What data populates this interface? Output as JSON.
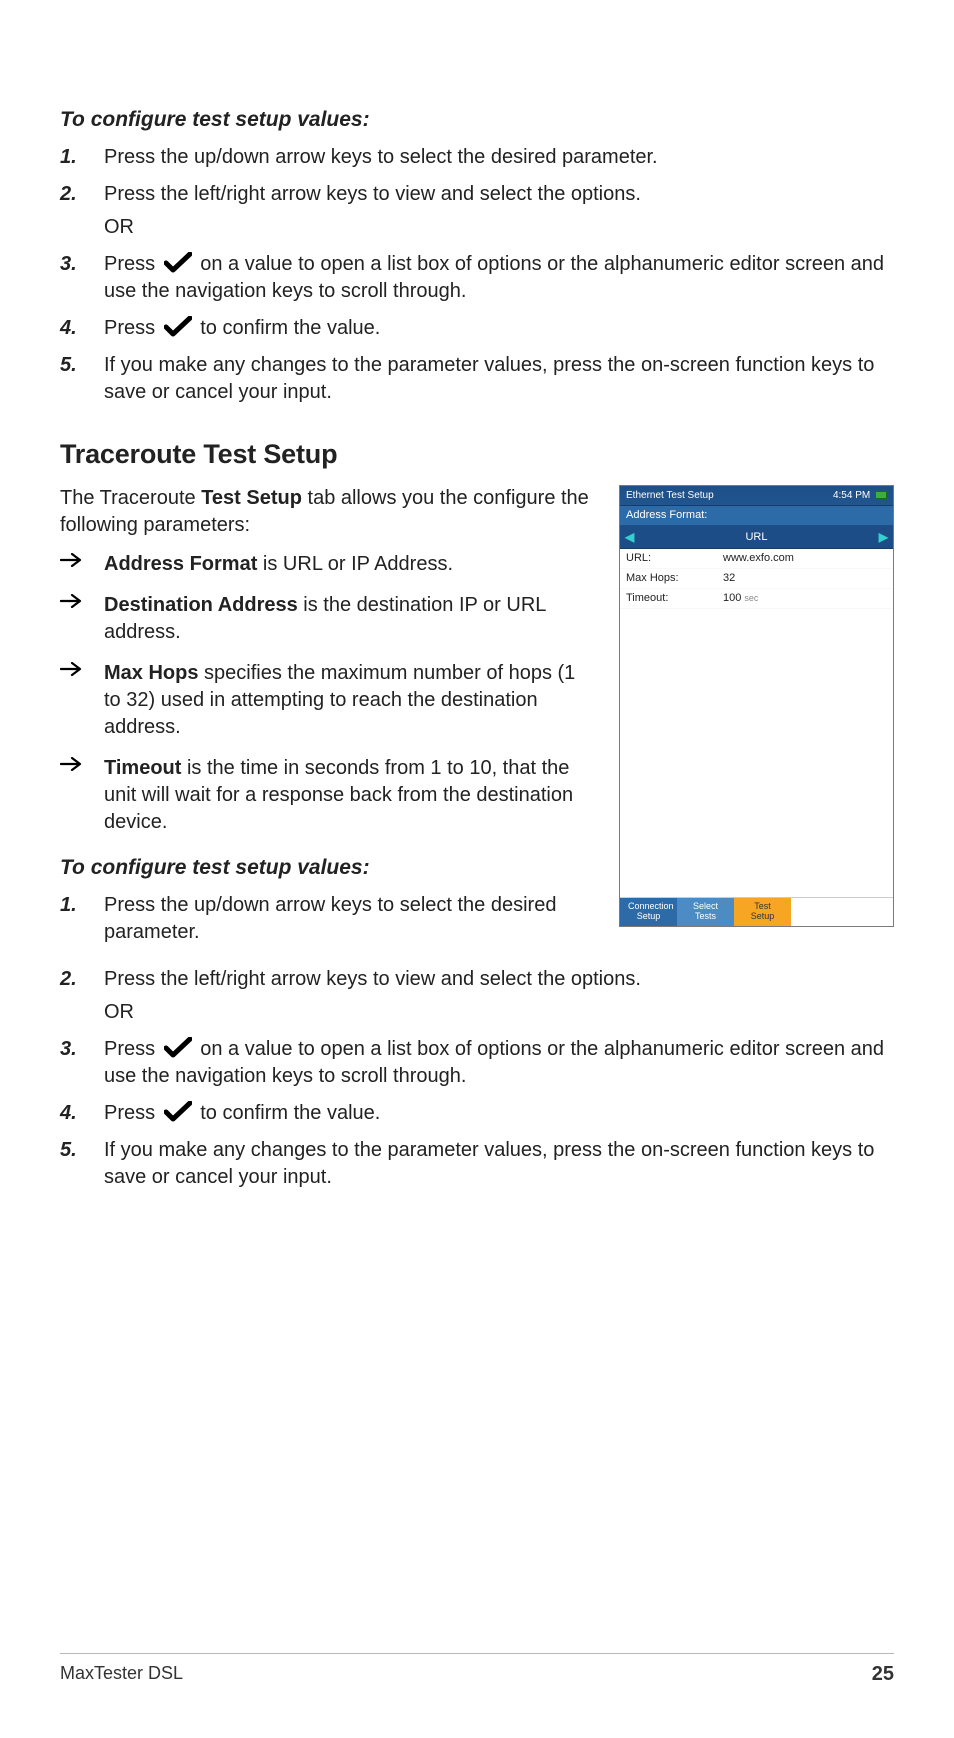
{
  "section1": {
    "heading": "To configure test setup values:",
    "items": {
      "n1": "1.",
      "t1": "Press the up/down arrow keys to select the desired parameter.",
      "n2": "2.",
      "t2": "Press the left/right arrow keys to view and select the options.",
      "or": "OR",
      "n3": "3.",
      "t3a": "Press ",
      "t3b": " on a value to open a list box of options or the alphanumeric editor screen and use the navigation keys to scroll through.",
      "n4": "4.",
      "t4a": "Press ",
      "t4b": " to confirm the value.",
      "n5": "5.",
      "t5": "If you make any changes to the parameter values, press the on-screen function keys to save or cancel your input."
    }
  },
  "h2": "Traceroute Test Setup",
  "intro_a": "The Traceroute ",
  "intro_bold": "Test Setup",
  "intro_b": " tab allows you the configure the following parameters:",
  "bullets": {
    "b1_bold": "Address Format",
    "b1_rest": " is URL or IP Address.",
    "b2_bold": "Destination Address",
    "b2_rest": " is the destination IP or URL address.",
    "b3_bold": "Max Hops",
    "b3_rest": " specifies the maximum number of hops (1 to 32) used in attempting to reach the destination address.",
    "b4_bold": "Timeout",
    "b4_rest": " is the time in seconds from 1 to 10, that the unit will wait for a response back from the destination device."
  },
  "section2": {
    "heading": "To configure test setup values:",
    "items": {
      "n1": "1.",
      "t1": "Press the up/down arrow keys to select the desired parameter.",
      "n2": "2.",
      "t2": "Press the left/right arrow keys to view and select the options.",
      "or": "OR",
      "n3": "3.",
      "t3a": "Press ",
      "t3b": " on a value to open a list box of options or the alphanumeric editor screen and use the navigation keys to scroll through.",
      "n4": "4.",
      "t4a": "Press ",
      "t4b": " to confirm the value.",
      "n5": "5.",
      "t5": "If you make any changes to the parameter values, press the on-screen function keys to save or cancel your input."
    }
  },
  "device": {
    "title": "Ethernet Test Setup",
    "time": "4:54 PM",
    "addr_format_label": "Address Format:",
    "selector_value": "URL",
    "rows": {
      "url_lbl": "URL:",
      "url_val": "www.exfo.com",
      "hops_lbl": "Max Hops:",
      "hops_val": "32",
      "timeout_lbl": "Timeout:",
      "timeout_val": "100",
      "timeout_unit": "sec"
    },
    "tabs": {
      "t1a": "Connection",
      "t1b": "Setup",
      "t2": "Select Tests",
      "t3": "Test Setup"
    }
  },
  "footer": {
    "left": "MaxTester DSL",
    "right": "25"
  }
}
